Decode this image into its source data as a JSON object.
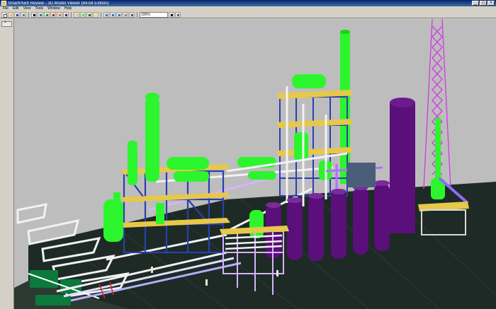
{
  "window": {
    "title": "SmartPlant Review - 3D Model Viewer (64-bit Edition)",
    "minimize_glyph": "_",
    "maximize_glyph": "□",
    "close_glyph": "×"
  },
  "menu": [
    "File",
    "Edit",
    "View",
    "Tools",
    "Window",
    "Help"
  ],
  "toolbar": {
    "zoom_value": "100%"
  },
  "side_panel": {
    "close_glyph": "×"
  },
  "colors": {
    "viewport_bg": "#bdbdbd",
    "ground": "#1e2a25",
    "vessel_green": "#2df52d",
    "tank_purple": "#5a0f7a",
    "steel_blue": "#2a3fb0",
    "pipe_white": "#f2f2f2",
    "platform_yellow": "#e6c84a"
  }
}
